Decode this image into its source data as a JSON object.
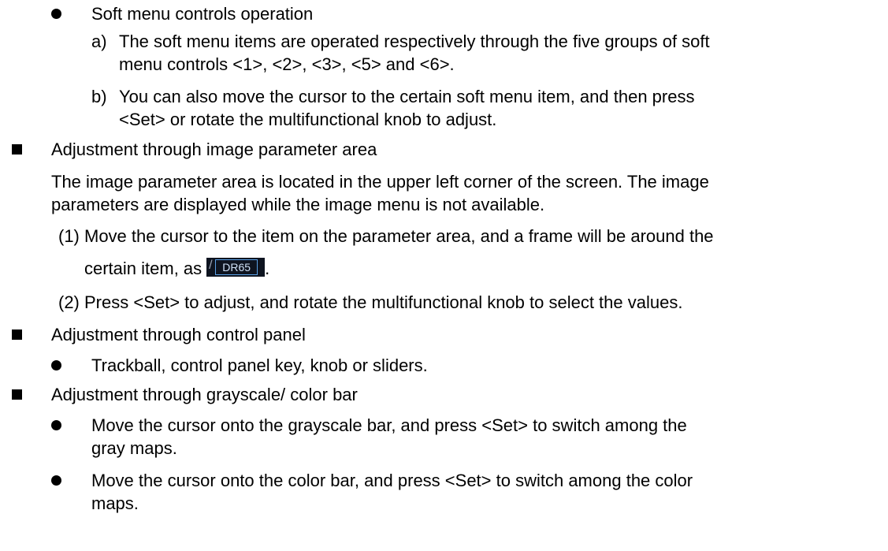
{
  "soft_menu": {
    "heading": "Soft menu controls operation",
    "items": [
      {
        "marker": "a)",
        "lines": [
          "The soft menu items are operated respectively through the five groups of soft",
          "menu controls <1>, <2>, <3>, <5> and <6>."
        ]
      },
      {
        "marker": "b)",
        "lines": [
          "You can also move the cursor to the certain soft menu item, and then press",
          "<Set> or rotate the multifunctional knob to adjust."
        ]
      }
    ]
  },
  "image_param": {
    "heading": "Adjustment through image parameter area",
    "para_lines": [
      "The image parameter area is located in the upper left corner of the screen. The image",
      "parameters are displayed while the image menu is not available."
    ],
    "steps": [
      {
        "marker": "(1)",
        "lines": [
          "Move the cursor to the item on the parameter area, and a frame will be around the",
          "certain item, as"
        ]
      },
      {
        "marker": "(2)",
        "lines": [
          "Press <Set> to adjust, and rotate the multifunctional knob to select the values."
        ]
      }
    ],
    "badge": {
      "slash": "/",
      "text": "DR65"
    }
  },
  "control_panel": {
    "heading": "Adjustment through control panel",
    "items": [
      "Trackball, control panel key, knob or sliders."
    ]
  },
  "bar": {
    "heading": "Adjustment through grayscale/ color bar",
    "items": [
      {
        "lines": [
          "Move the cursor onto the grayscale bar, and press <Set> to switch among the",
          "gray maps."
        ]
      },
      {
        "lines": [
          "Move the cursor onto the color bar, and press <Set> to switch among the color",
          "maps."
        ]
      }
    ]
  }
}
